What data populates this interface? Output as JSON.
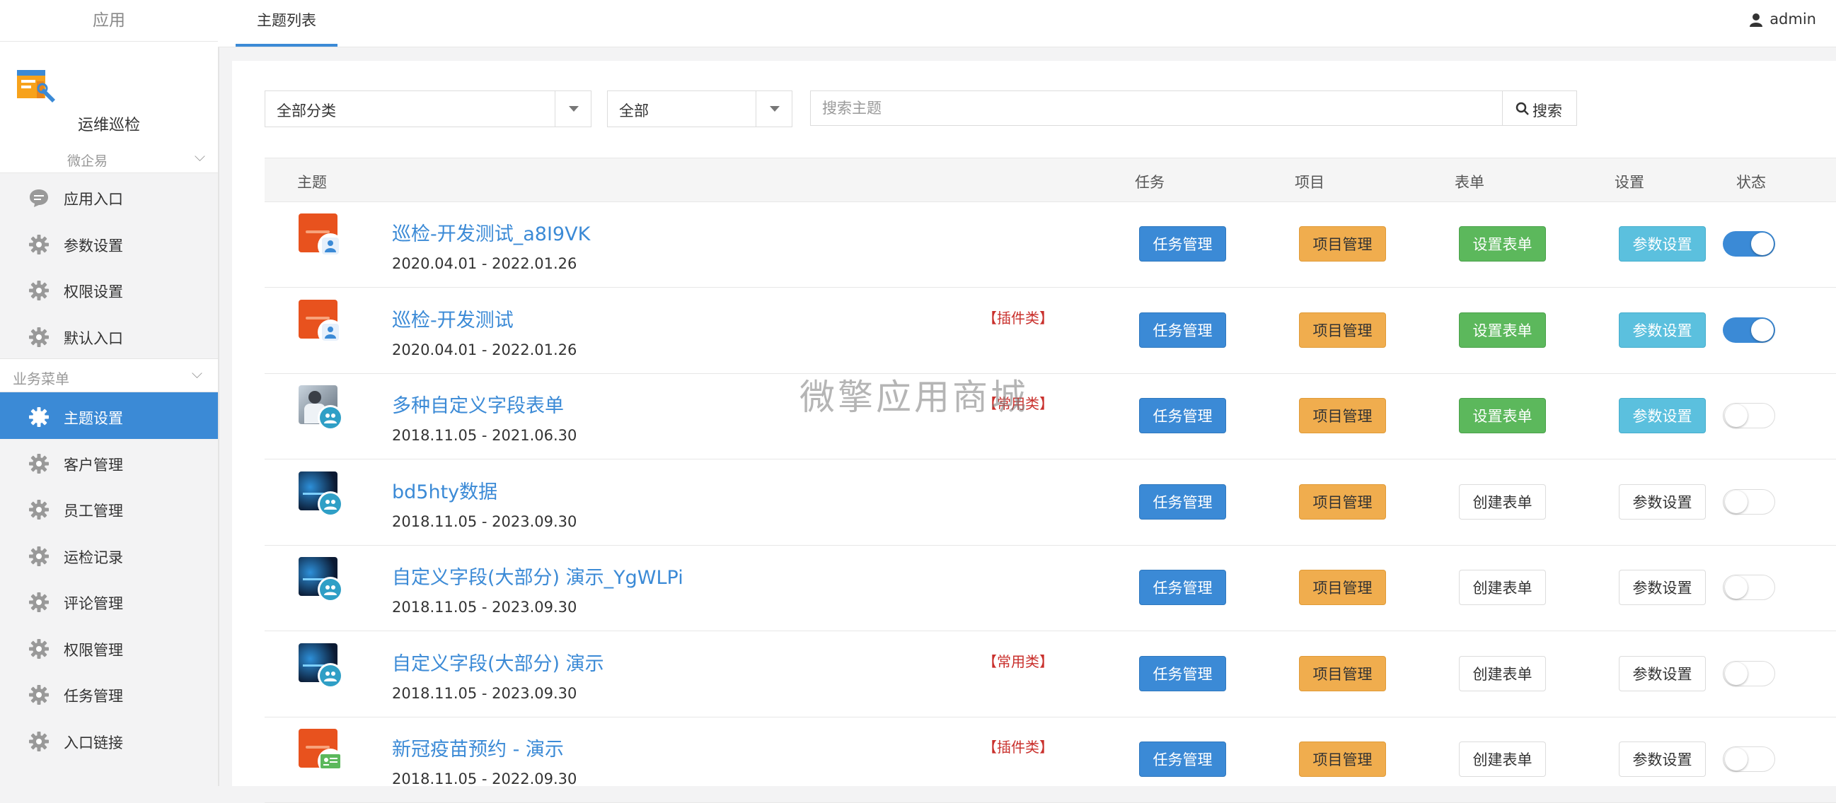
{
  "sidebar": {
    "apps_label": "应用",
    "brand_name": "运维巡检",
    "sub_label": "微企易",
    "items_top": [
      {
        "label": "应用入口",
        "icon": "chat-bubble-icon"
      },
      {
        "label": "参数设置",
        "icon": "gear-icon"
      },
      {
        "label": "权限设置",
        "icon": "gear-icon"
      },
      {
        "label": "默认入口",
        "icon": "gear-icon"
      }
    ],
    "group_label": "业务菜单",
    "items_biz": [
      {
        "label": "主题设置",
        "icon": "gear-icon",
        "active": true
      },
      {
        "label": "客户管理",
        "icon": "gear-icon"
      },
      {
        "label": "员工管理",
        "icon": "gear-icon"
      },
      {
        "label": "运检记录",
        "icon": "gear-icon"
      },
      {
        "label": "评论管理",
        "icon": "gear-icon"
      },
      {
        "label": "权限管理",
        "icon": "gear-icon"
      },
      {
        "label": "任务管理",
        "icon": "gear-icon"
      },
      {
        "label": "入口链接",
        "icon": "gear-icon"
      }
    ]
  },
  "topbar": {
    "tab_label": "主题列表",
    "user_name": "admin"
  },
  "filters": {
    "category_value": "全部分类",
    "status_value": "全部",
    "search_placeholder": "搜索主题",
    "search_button": "搜索"
  },
  "table": {
    "headers": {
      "topic": "主题",
      "task": "任务",
      "project": "项目",
      "form": "表单",
      "settings": "设置",
      "status": "状态"
    },
    "rows": [
      {
        "title": "巡检-开发测试_a8I9VK",
        "date": "2020.04.01 - 2022.01.26",
        "tag": "",
        "task": "任务管理",
        "project": "项目管理",
        "form": "设置表单",
        "form_style": "green",
        "settings": "参数设置",
        "settings_style": "cyan",
        "enabled": true,
        "thumb": "orange",
        "badge": "person"
      },
      {
        "title": "巡检-开发测试",
        "date": "2020.04.01 - 2022.01.26",
        "tag": "【插件类】",
        "task": "任务管理",
        "project": "项目管理",
        "form": "设置表单",
        "form_style": "green",
        "settings": "参数设置",
        "settings_style": "cyan",
        "enabled": true,
        "thumb": "orange",
        "badge": "person"
      },
      {
        "title": "多种自定义字段表单",
        "date": "2018.11.05 - 2021.06.30",
        "tag": "【常用类】",
        "task": "任务管理",
        "project": "项目管理",
        "form": "设置表单",
        "form_style": "green",
        "settings": "参数设置",
        "settings_style": "cyan",
        "enabled": false,
        "thumb": "photo",
        "badge": "teal"
      },
      {
        "title": "bd5hty数据",
        "date": "2018.11.05 - 2023.09.30",
        "tag": "",
        "task": "任务管理",
        "project": "项目管理",
        "form": "创建表单",
        "form_style": "white",
        "settings": "参数设置",
        "settings_style": "white",
        "enabled": false,
        "thumb": "dark",
        "badge": "teal"
      },
      {
        "title": "自定义字段(大部分) 演示_YgWLPi",
        "date": "2018.11.05 - 2023.09.30",
        "tag": "",
        "task": "任务管理",
        "project": "项目管理",
        "form": "创建表单",
        "form_style": "white",
        "settings": "参数设置",
        "settings_style": "white",
        "enabled": false,
        "thumb": "dark",
        "badge": "teal"
      },
      {
        "title": "自定义字段(大部分) 演示",
        "date": "2018.11.05 - 2023.09.30",
        "tag": "【常用类】",
        "task": "任务管理",
        "project": "项目管理",
        "form": "创建表单",
        "form_style": "white",
        "settings": "参数设置",
        "settings_style": "white",
        "enabled": false,
        "thumb": "dark",
        "badge": "teal"
      },
      {
        "title": "新冠疫苗预约 - 演示",
        "date": "2018.11.05 - 2022.09.30",
        "tag": "【插件类】",
        "task": "任务管理",
        "project": "项目管理",
        "form": "创建表单",
        "form_style": "white",
        "settings": "参数设置",
        "settings_style": "white",
        "enabled": false,
        "thumb": "orange",
        "badge": "card"
      }
    ]
  },
  "watermark": "微擎应用商城",
  "colors": {
    "primary": "#3b8ad6",
    "orange": "#f0ad4e",
    "green": "#5cb85c",
    "cyan": "#5bc0de",
    "tag_red": "#c9302c"
  }
}
